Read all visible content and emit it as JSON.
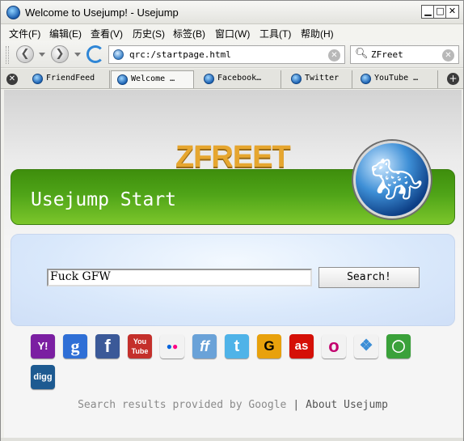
{
  "window": {
    "title": "Welcome to Usejump! - Usejump",
    "min": "▁",
    "max": "□",
    "close": "✕"
  },
  "menu": [
    "文件(F)",
    "编辑(E)",
    "查看(V)",
    "历史(S)",
    "标签(B)",
    "窗口(W)",
    "工具(T)",
    "帮助(H)"
  ],
  "toolbar": {
    "url": "qrc:/startpage.html",
    "search_engine": "ZFreet",
    "back": "❮",
    "forward": "❯",
    "clear": "✕"
  },
  "tabs": [
    {
      "label": "FriendFeed"
    },
    {
      "label": "Welcome …"
    },
    {
      "label": "Facebook…"
    },
    {
      "label": "Twitter"
    },
    {
      "label": "YouTube …"
    }
  ],
  "tab_controls": {
    "close": "✕",
    "new": "+"
  },
  "page": {
    "logo": "ZFREET",
    "banner_title": "Usejump Start",
    "search_value": "Fuck GFW",
    "search_button": "Search!",
    "footer_provider": "Search results provided by Google",
    "footer_sep": "|",
    "footer_about": "About Usejump"
  },
  "services": [
    {
      "name": "yahoo-icon",
      "glyph": "Y!",
      "color": "#7b1fa2"
    },
    {
      "name": "google-icon",
      "glyph": "g",
      "color": "#2f6fd6"
    },
    {
      "name": "facebook-icon",
      "glyph": "f",
      "color": "#3b5998"
    },
    {
      "name": "youtube-icon",
      "glyph": "You Tube",
      "color": "#c4302b"
    },
    {
      "name": "flickr-icon",
      "glyph": "●●",
      "color": "#f2f2f2"
    },
    {
      "name": "friendfeed-icon",
      "glyph": "ff",
      "color": "#6aa2d8"
    },
    {
      "name": "twitter-icon",
      "glyph": "t",
      "color": "#4fb3e8"
    },
    {
      "name": "gmail-icon",
      "glyph": "G",
      "color": "#e8a10c"
    },
    {
      "name": "lastfm-icon",
      "glyph": "as",
      "color": "#d51007"
    },
    {
      "name": "orkut-icon",
      "glyph": "o",
      "color": "#f2f2f2"
    },
    {
      "name": "windows-icon",
      "glyph": "❖",
      "color": "#f2f2f2"
    },
    {
      "name": "chat-icon",
      "glyph": "▬",
      "color": "#3aa13a"
    },
    {
      "name": "digg-icon",
      "glyph": "digg",
      "color": "#1d5a91"
    }
  ]
}
